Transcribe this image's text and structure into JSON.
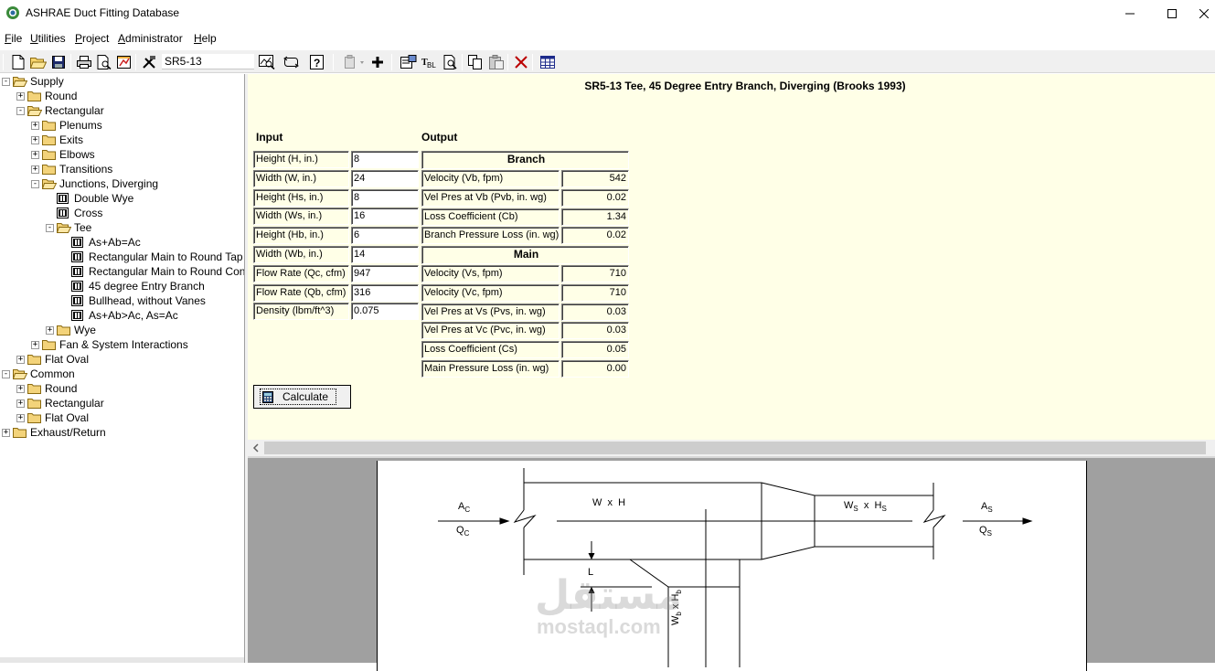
{
  "window": {
    "title": "ASHRAE Duct Fitting Database"
  },
  "menu": [
    {
      "label": "File",
      "u": "F",
      "rest": "ile"
    },
    {
      "label": "Utilities",
      "u": "U",
      "rest": "tilities"
    },
    {
      "label": "Project",
      "u": "P",
      "rest": "roject"
    },
    {
      "label": "Administrator",
      "u": "A",
      "rest": "dministrator"
    },
    {
      "label": "Help",
      "u": "H",
      "rest": "elp"
    }
  ],
  "toolbar": {
    "fitting_code": "SR5-13"
  },
  "tree": [
    {
      "label": "Supply",
      "level": 0,
      "expander": "-",
      "icon": "folder-open-icon"
    },
    {
      "label": "Round",
      "level": 1,
      "expander": "+",
      "icon": "folder-icon"
    },
    {
      "label": "Rectangular",
      "level": 1,
      "expander": "-",
      "icon": "folder-open-icon"
    },
    {
      "label": "Plenums",
      "level": 2,
      "expander": "+",
      "icon": "folder-icon"
    },
    {
      "label": "Exits",
      "level": 2,
      "expander": "+",
      "icon": "folder-icon"
    },
    {
      "label": "Elbows",
      "level": 2,
      "expander": "+",
      "icon": "folder-icon"
    },
    {
      "label": "Transitions",
      "level": 2,
      "expander": "+",
      "icon": "folder-icon"
    },
    {
      "label": "Junctions, Diverging",
      "level": 2,
      "expander": "-",
      "icon": "folder-open-icon"
    },
    {
      "label": "Double Wye",
      "level": 3,
      "expander": "",
      "icon": "fitting-icon"
    },
    {
      "label": "Cross",
      "level": 3,
      "expander": "",
      "icon": "fitting-icon"
    },
    {
      "label": "Tee",
      "level": 3,
      "expander": "-",
      "icon": "folder-open-icon"
    },
    {
      "label": "As+Ab=Ac",
      "level": 4,
      "expander": "",
      "icon": "fitting-icon"
    },
    {
      "label": "Rectangular Main to Round Tap",
      "level": 4,
      "expander": "",
      "icon": "fitting-icon"
    },
    {
      "label": "Rectangular Main to Round Conical",
      "level": 4,
      "expander": "",
      "icon": "fitting-icon"
    },
    {
      "label": "45 degree Entry Branch",
      "level": 4,
      "expander": "",
      "icon": "fitting-icon"
    },
    {
      "label": "Bullhead, without Vanes",
      "level": 4,
      "expander": "",
      "icon": "fitting-icon"
    },
    {
      "label": "As+Ab>Ac, As=Ac",
      "level": 4,
      "expander": "",
      "icon": "fitting-icon"
    },
    {
      "label": "Wye",
      "level": 3,
      "expander": "+",
      "icon": "folder-icon"
    },
    {
      "label": "Fan & System Interactions",
      "level": 2,
      "expander": "+",
      "icon": "folder-icon"
    },
    {
      "label": "Flat Oval",
      "level": 1,
      "expander": "+",
      "icon": "folder-icon"
    },
    {
      "label": "Common",
      "level": 0,
      "expander": "-",
      "icon": "folder-open-icon"
    },
    {
      "label": "Round",
      "level": 1,
      "expander": "+",
      "icon": "folder-icon"
    },
    {
      "label": "Rectangular",
      "level": 1,
      "expander": "+",
      "icon": "folder-icon"
    },
    {
      "label": "Flat Oval",
      "level": 1,
      "expander": "+",
      "icon": "folder-icon"
    },
    {
      "label": "Exhaust/Return",
      "level": 0,
      "expander": "+",
      "icon": "folder-icon"
    }
  ],
  "form": {
    "title": "SR5-13  Tee, 45 Degree Entry Branch, Diverging (Brooks 1993)",
    "input_label": "Input",
    "output_label": "Output",
    "inputs": [
      {
        "label": "Height (H, in.)",
        "value": "8"
      },
      {
        "label": "Width (W, in.)",
        "value": "24"
      },
      {
        "label": "Height (Hs, in.)",
        "value": "8"
      },
      {
        "label": "Width (Ws, in.)",
        "value": "16"
      },
      {
        "label": "Height (Hb, in.)",
        "value": "6"
      },
      {
        "label": "Width (Wb, in.)",
        "value": "14"
      },
      {
        "label": "Flow Rate (Qc, cfm)",
        "value": "947"
      },
      {
        "label": "Flow Rate (Qb, cfm)",
        "value": "316"
      },
      {
        "label": "Density (lbm/ft^3)",
        "value": "0.075"
      }
    ],
    "branch_header": "Branch",
    "branch": [
      {
        "label": "Velocity (Vb, fpm)",
        "value": "542"
      },
      {
        "label": "Vel Pres at Vb (Pvb, in. wg)",
        "value": "0.02"
      },
      {
        "label": "Loss Coefficient (Cb)",
        "value": "1.34"
      },
      {
        "label": "Branch Pressure Loss (in. wg)",
        "value": "0.02"
      }
    ],
    "main_header": "Main",
    "main": [
      {
        "label": "Velocity (Vs, fpm)",
        "value": "710"
      },
      {
        "label": "Velocity (Vc, fpm)",
        "value": "710"
      },
      {
        "label": "Vel Pres at Vs (Pvs, in. wg)",
        "value": "0.03"
      },
      {
        "label": "Vel Pres at Vc (Pvc, in. wg)",
        "value": "0.03"
      },
      {
        "label": "Loss Coefficient (Cs)",
        "value": "0.05"
      },
      {
        "label": "Main Pressure Loss (in. wg)",
        "value": "0.00"
      }
    ],
    "calculate_label": "Calculate"
  },
  "diagram": {
    "ac": "A",
    "ac_sub": "C",
    "qc": "Q",
    "qc_sub": "C",
    "wh": "W  x  H",
    "ws": "W",
    "ws_sub": "S",
    "x": "x",
    "hs": "H",
    "hs_sub": "S",
    "as": "A",
    "as_sub": "S",
    "qs": "Q",
    "qs_sub": "S",
    "l": "L",
    "wb": "W",
    "wb_sub": "b",
    "hb": "H",
    "hb_sub": "b"
  },
  "watermark": {
    "arabic": "مستقل",
    "latin": "mostaql.com"
  }
}
